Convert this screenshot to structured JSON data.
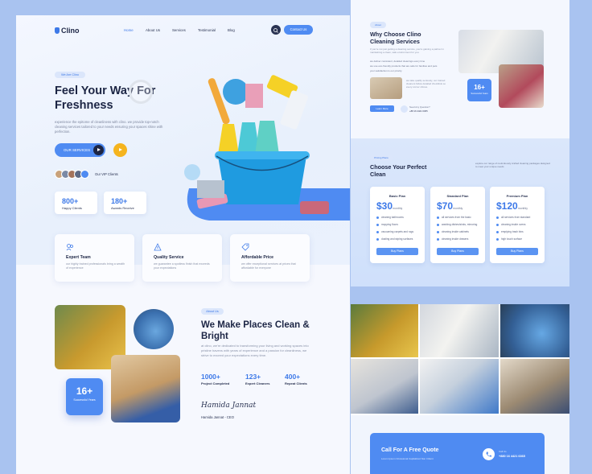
{
  "brand": {
    "logo": "Clino",
    "accent": "#4f8bf2",
    "dark": "#1c2544",
    "yellow": "#f5b41e",
    "background": "#a9c3f0"
  },
  "nav": {
    "links": [
      "Home",
      "About Us",
      "Services",
      "Testimonial",
      "Blog"
    ],
    "active": "Home",
    "search_icon": "search-icon",
    "cta": "Contact Us"
  },
  "hero": {
    "pill": "We Are Clino",
    "title": "Feel Your Way For Freshness",
    "description": "experience the epitome of cleanliness with clino. we provide top-notch cleaning services tailored to your needs ensuring your spaces shine with perfection.",
    "primary_button": "OUR SERVICES",
    "vip_label": "Our VIP Clients",
    "stats": [
      {
        "value": "800+",
        "label": "Happy Clients"
      },
      {
        "value": "180+",
        "label": "Awards Receive"
      }
    ]
  },
  "features": [
    {
      "title": "Expert Team",
      "description": "our highly trained professionals bring a wealth of experience",
      "icon": "team-icon"
    },
    {
      "title": "Quality Service",
      "description": "we guarantee a spotless finish that exceeds your expectations",
      "icon": "quality-icon"
    },
    {
      "title": "Affordable Price",
      "description": "we offer exceptional services at prices that affordable for everyone",
      "icon": "price-tag-icon"
    }
  ],
  "about": {
    "pill": "About Us",
    "title": "We Make Places Clean & Bright",
    "description": "at clino, we're dedicated to transforming your living and working spaces into pristine havens with years of experience and a passion for cleanliness, we strive to exceed your expectations every time.",
    "stats": [
      {
        "value": "1000+",
        "label": "Project Completed"
      },
      {
        "value": "123+",
        "label": "Expert Cleaners"
      },
      {
        "value": "400+",
        "label": "Repeat Clients"
      }
    ],
    "signature": "Hamida Jannat",
    "ceo": "Hamida Jannat - CEO",
    "years_value": "16+",
    "years_label": "Successful Years"
  },
  "why": {
    "pill": "About",
    "title": "Why Choose Clino Cleaning Services",
    "description": "if you're not just getting a cleaning service, you're gaining a partner in maintaining a clean, safe environment for you.",
    "bullets": [
      "we deliver consistent, detailed cleanings every time",
      "we use eco-friendly products that are safe for families and pets",
      "your satisfaction is our priority"
    ],
    "side_text": "we take quality seriously, our trained cleaners follow detailed checklists so every corner shines.",
    "button": "Learn More",
    "years_value": "16+",
    "years_label": "Successful Years",
    "phone_label": "Need Any Question?",
    "phone": "+88 16 4421 6365"
  },
  "plans": {
    "pill": "Pricing Plans",
    "title": "Choose Your Perfect Clean",
    "description": "explore our range of meticulously crafted cleaning packages designed to meet your unique needs",
    "items": [
      {
        "name": "Basic Plan",
        "price": "$30",
        "period": "monthly",
        "features": [
          "cleaning bathrooms",
          "mopping floors",
          "vacuuming carpets and rugs",
          "dusting and wiping surfaces"
        ],
        "button": "Buy Plans"
      },
      {
        "name": "Standard Plan",
        "price": "$70",
        "period": "monthly",
        "features": [
          "all services from the basic",
          "washing dishes/sinks, mirroring",
          "cleaning inside cabinets",
          "cleaning inside drawers"
        ],
        "button": "Buy Plans"
      },
      {
        "name": "Premium Plan",
        "price": "$120",
        "period": "monthly",
        "features": [
          "all services from standard",
          "cleaning inside ovens",
          "emptying trash bins",
          "high touch surface"
        ],
        "button": "Buy Plans"
      }
    ]
  },
  "quote": {
    "title": "Call For A Free Quote",
    "description": "Lorem Ipsum Occasional Capitalized Non Irritant",
    "phone_label": "Call Us",
    "phone": "+880 16 4421 6365"
  }
}
